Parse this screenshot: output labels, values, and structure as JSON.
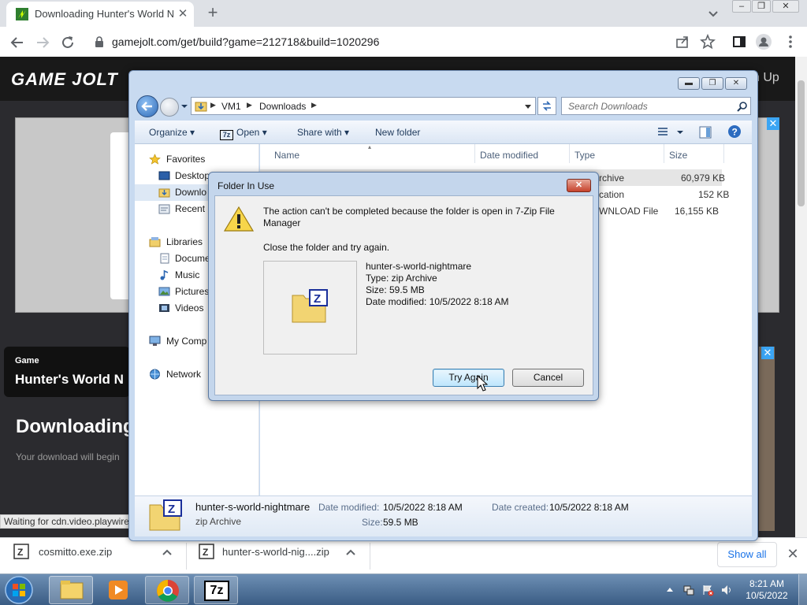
{
  "browser": {
    "tab_title": "Downloading Hunter's World Nig",
    "tab_close": "✕",
    "new_tab": "+",
    "url": "gamejolt.com/get/build?game=212718&build=1020296"
  },
  "page": {
    "logo": "GAME JOLT",
    "signup": "n Up",
    "game_kind": "Game",
    "game_name": "Hunter's World N",
    "heading": "Downloading",
    "subtext": "Your download will begin",
    "ad_close": "✕",
    "status": "Waiting for cdn.video.playwire"
  },
  "downloads": {
    "items": [
      {
        "name": "cosmitto.exe.zip",
        "icon": "zip-file-icon"
      },
      {
        "name": "hunter-s-world-nig....zip",
        "icon": "zip-file-icon"
      }
    ],
    "show_all": "Show all",
    "close": "✕"
  },
  "explorer": {
    "breadcrumb": [
      "VM1",
      "Downloads"
    ],
    "search_placeholder": "Search Downloads",
    "commands": {
      "organize": "Organize",
      "open": "Open",
      "share": "Share with",
      "new_folder": "New folder"
    },
    "nav": [
      {
        "label": "Favorites",
        "icon": "star-icon"
      },
      {
        "label": "Desktop",
        "icon": "desktop-icon"
      },
      {
        "label": "Downlo",
        "icon": "downloads-folder-icon"
      },
      {
        "label": "Recent P",
        "icon": "recent-places-icon"
      },
      {
        "label": "Libraries",
        "icon": "libraries-icon"
      },
      {
        "label": "Docume",
        "icon": "documents-icon"
      },
      {
        "label": "Music",
        "icon": "music-icon"
      },
      {
        "label": "Pictures",
        "icon": "pictures-icon"
      },
      {
        "label": "Videos",
        "icon": "videos-icon"
      },
      {
        "label": "My Comp",
        "icon": "computer-icon"
      },
      {
        "label": "Network",
        "icon": "network-icon"
      }
    ],
    "columns": {
      "name": "Name",
      "date": "Date modified",
      "type": "Type",
      "size": "Size"
    },
    "rows": [
      {
        "type": "rchive",
        "size": "60,979 KB"
      },
      {
        "type": "cation",
        "size": "152 KB"
      },
      {
        "type": "WNLOAD File",
        "size": "16,155 KB"
      }
    ],
    "details": {
      "name": "hunter-s-world-nightmare",
      "kind": "zip Archive",
      "date_modified_label": "Date modified:",
      "date_modified": "10/5/2022 8:18 AM",
      "date_created_label": "Date created:",
      "date_created": "10/5/2022 8:18 AM",
      "size_label": "Size:",
      "size": "59.5 MB"
    }
  },
  "dialog": {
    "title": "Folder In Use",
    "message": "The action can't be completed because the folder is open in 7-Zip File Manager",
    "hint": "Close the folder and try again.",
    "file_name": "hunter-s-world-nightmare",
    "file_type": "Type: zip Archive",
    "file_size": "Size: 59.5 MB",
    "file_date": "Date modified: 10/5/2022 8:18 AM",
    "try_again": "Try Again",
    "cancel": "Cancel",
    "close": "✕"
  },
  "taskbar": {
    "time": "8:21 AM",
    "date": "10/5/2022",
    "app_7zip": "7z"
  }
}
